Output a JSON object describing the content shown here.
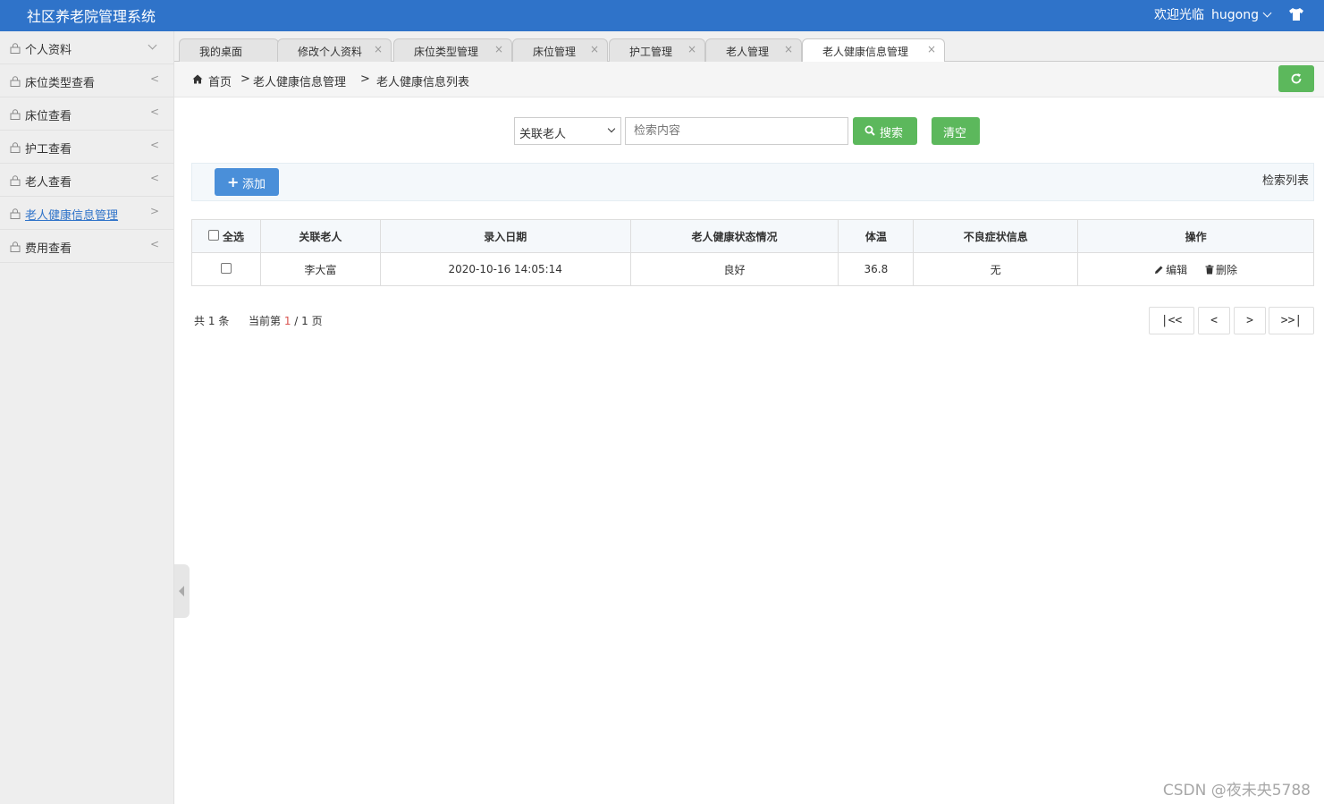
{
  "header": {
    "app_title": "社区养老院管理系统",
    "welcome_text": "欢迎光临",
    "username": "hugong",
    "icons": [
      "chevron-down-icon",
      "shirt-icon"
    ]
  },
  "sidebar": {
    "items": [
      {
        "label": "个人资料",
        "arrow": "down"
      },
      {
        "label": "床位类型查看",
        "arrow": "<"
      },
      {
        "label": "床位查看",
        "arrow": "<"
      },
      {
        "label": "护工查看",
        "arrow": "<"
      },
      {
        "label": "老人查看",
        "arrow": "<"
      },
      {
        "label": "老人健康信息管理",
        "arrow": ">",
        "active": true
      },
      {
        "label": "费用查看",
        "arrow": "<"
      }
    ]
  },
  "tabs": [
    {
      "label": "我的桌面",
      "closable": false
    },
    {
      "label": "修改个人资料",
      "closable": true
    },
    {
      "label": "床位类型管理",
      "closable": true
    },
    {
      "label": "床位管理",
      "closable": true
    },
    {
      "label": "护工管理",
      "closable": true
    },
    {
      "label": "老人管理",
      "closable": true
    },
    {
      "label": "老人健康信息管理",
      "closable": true,
      "active": true
    }
  ],
  "tab_close_glyph": "×",
  "breadcrumb": {
    "home": "首页",
    "sep": ">",
    "level1": "老人健康信息管理",
    "level2": "老人健康信息列表"
  },
  "search": {
    "field_selected": "关联老人",
    "placeholder": "检索内容",
    "search_label": "搜索",
    "clear_label": "清空"
  },
  "toolbar": {
    "add_label": "添加",
    "list_label": "检索列表"
  },
  "table": {
    "select_all_label": "全选",
    "columns": [
      "关联老人",
      "录入日期",
      "老人健康状态情况",
      "体温",
      "不良症状信息",
      "操作"
    ],
    "rows": [
      {
        "elder": "李大富",
        "date": "2020-10-16 14:05:14",
        "health": "良好",
        "temperature": "36.8",
        "symptoms": "无"
      }
    ],
    "edit_label": "编辑",
    "delete_label": "删除"
  },
  "pager": {
    "total_prefix": "共",
    "total": "1",
    "total_suffix": "条",
    "current_prefix": "当前第",
    "current_page": "1",
    "page_sep": "/",
    "total_pages": "1",
    "page_suffix": "页",
    "first": "|<<",
    "prev": "<",
    "next": ">",
    "last": ">>|"
  },
  "watermark": "CSDN @夜未央5788",
  "colors": {
    "header_bg": "#2f73c9",
    "green_button": "#5cb85c",
    "add_button": "#4a8fd9",
    "active_link": "#2f73c9",
    "current_page": "#d9534f"
  }
}
